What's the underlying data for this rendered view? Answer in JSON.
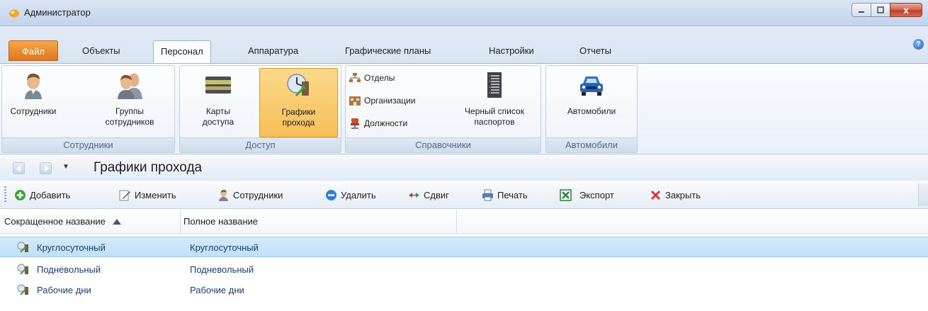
{
  "window": {
    "title": "Администратор",
    "buttons": {
      "minimize": "–",
      "maximize": "□",
      "close": "x"
    }
  },
  "ribbon_tabs": [
    {
      "label": "Файл"
    },
    {
      "label": "Объекты"
    },
    {
      "label": "Персонал"
    },
    {
      "label": "Аппаратура"
    },
    {
      "label": "Графические планы"
    },
    {
      "label": "Настройки"
    },
    {
      "label": "Отчеты"
    }
  ],
  "active_tab": "Персонал",
  "help_icon": "?",
  "ribbon": {
    "groups": {
      "employees": {
        "label": "Сотрудники",
        "buttons": {
          "employees": "Сотрудники",
          "groups_line1": "Группы",
          "groups_line2": "сотрудников"
        }
      },
      "access": {
        "label": "Доступ",
        "buttons": {
          "cards_line1": "Карты",
          "cards_line2": "доступа",
          "schedules_line1": "Графики",
          "schedules_line2": "прохода"
        }
      },
      "references": {
        "label": "Справочники",
        "buttons": {
          "departments": "Отделы",
          "organizations": "Организации",
          "positions": "Должности",
          "blacklist_line1": "Черный список",
          "blacklist_line2": "паспортов"
        }
      },
      "vehicles": {
        "label": "Автомобили",
        "buttons": {
          "vehicles": "Автомобили"
        }
      }
    }
  },
  "nav": {
    "title": "Графики прохода",
    "dropdown": "▼"
  },
  "toolbar": {
    "add": "Добавить",
    "edit": "Изменить",
    "employees": "Сотрудники",
    "delete": "Удалить",
    "shift": "Сдвиг",
    "print": "Печать",
    "export": "Экспорт",
    "close": "Закрыть"
  },
  "grid": {
    "columns": [
      "Сокращенное название",
      "Полное название"
    ],
    "sorted_column": "Сокращенное название",
    "rows": [
      {
        "short": "Круглосуточный",
        "full": "Круглосуточный",
        "selected": true
      },
      {
        "short": "Подневольный",
        "full": "Подневольный",
        "selected": false
      },
      {
        "short": "Рабочие дни",
        "full": "Рабочие дни",
        "selected": false
      }
    ]
  },
  "colors": {
    "accent_file_tab": "#e0761c",
    "active_button": "#f6bf58",
    "selection": "#c7e4f7",
    "row_text": "#1a3e7a"
  }
}
